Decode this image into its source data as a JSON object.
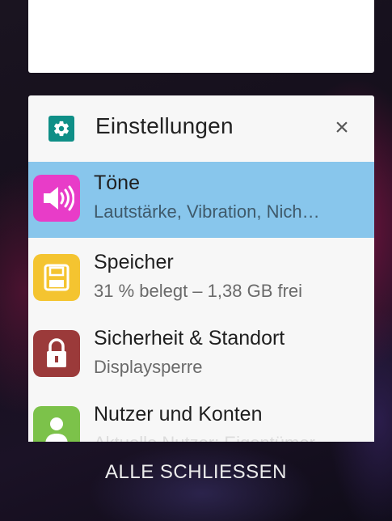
{
  "recents": {
    "card": {
      "app_name": "Einstellungen",
      "app_icon": "gear-icon",
      "close_label": "×",
      "items": [
        {
          "title": "Töne",
          "subtitle": "Lautstärke, Vibration, Nich…",
          "icon": "speaker-icon",
          "color": "#e83cc8",
          "selected": true
        },
        {
          "title": "Speicher",
          "subtitle": "31 % belegt – 1,38 GB frei",
          "icon": "storage-icon",
          "color": "#f4c430"
        },
        {
          "title": "Sicherheit & Standort",
          "subtitle": "Displaysperre",
          "icon": "lock-icon",
          "color": "#9b3a3a"
        },
        {
          "title": "Nutzer und Konten",
          "subtitle": "Aktuelle Nutzer: Eigentümer",
          "icon": "user-icon",
          "color": "#7cc24a"
        }
      ]
    },
    "close_all_label": "ALLE SCHLIESSEN"
  },
  "colors": {
    "selected_row": "#88c6ec",
    "settings_icon": "#0f8f87"
  }
}
